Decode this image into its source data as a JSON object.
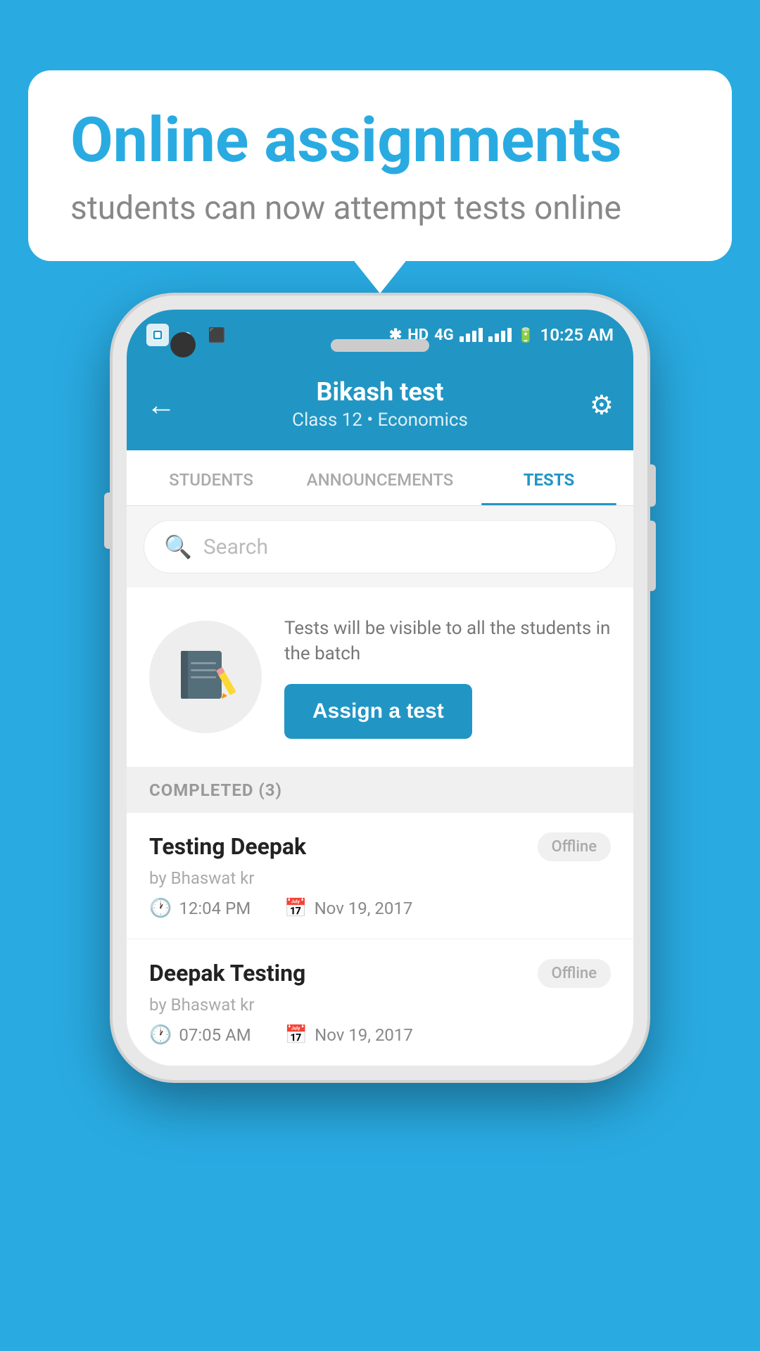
{
  "bubble": {
    "title": "Online assignments",
    "subtitle": "students can now attempt tests online"
  },
  "status_bar": {
    "time": "10:25 AM",
    "network": "HD 4G",
    "icons": [
      "app1",
      "whatsapp",
      "gallery"
    ]
  },
  "header": {
    "title": "Bikash test",
    "subtitle": "Class 12 • Economics",
    "back_label": "←",
    "settings_label": "⚙"
  },
  "tabs": [
    {
      "id": "students",
      "label": "STUDENTS",
      "active": false
    },
    {
      "id": "announcements",
      "label": "ANNOUNCEMENTS",
      "active": false
    },
    {
      "id": "tests",
      "label": "TESTS",
      "active": true
    }
  ],
  "search": {
    "placeholder": "Search"
  },
  "assign_section": {
    "description": "Tests will be visible to all the students in the batch",
    "button_label": "Assign a test"
  },
  "completed_section": {
    "header": "COMPLETED (3)"
  },
  "test_items": [
    {
      "name": "Testing Deepak",
      "author": "by Bhaswat kr",
      "time": "12:04 PM",
      "date": "Nov 19, 2017",
      "status": "Offline"
    },
    {
      "name": "Deepak Testing",
      "author": "by Bhaswat kr",
      "time": "07:05 AM",
      "date": "Nov 19, 2017",
      "status": "Offline"
    }
  ]
}
